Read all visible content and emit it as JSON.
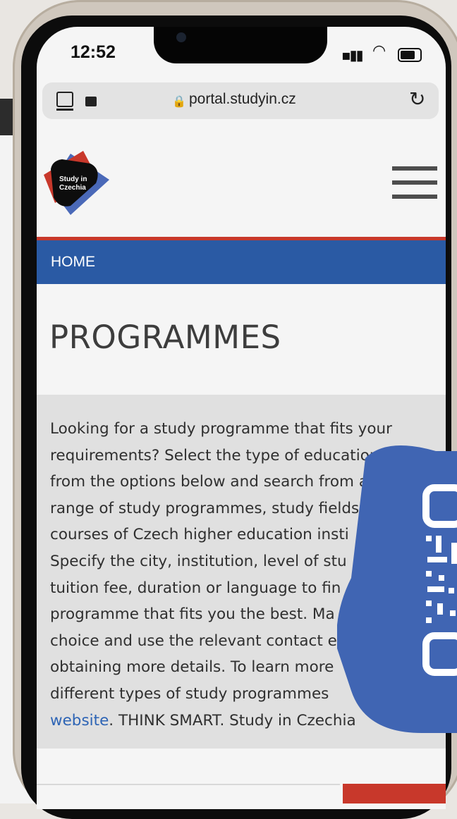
{
  "status_bar": {
    "time": "12:52"
  },
  "browser": {
    "url": "portal.studyin.cz"
  },
  "logo": {
    "line1": "Study in",
    "line2": "Czechia"
  },
  "breadcrumb": {
    "home": "HOME"
  },
  "page": {
    "title": "PROGRAMMES"
  },
  "intro": {
    "lines": [
      "Looking for a study programme that fits your",
      "requirements? Select the type of education",
      "from the options below and search from a",
      "range of study programmes, study fields",
      "courses of Czech higher education insti",
      "Specify the city, institution, level of stu",
      "tuition fee, duration or language to fin",
      "programme that fits you the best. Ma",
      "choice and use the relevant contact e",
      "obtaining more details. To learn more",
      "different types of study programmes"
    ],
    "link_text": "website",
    "tail_text": ". THINK SMART. Study in Czechia"
  },
  "colors": {
    "brand_blue": "#2a5aa4",
    "brand_red": "#c8382b",
    "badge_blue": "#4065b3"
  },
  "icons": {
    "tabs": "tabs-icon",
    "extension": "extension-icon",
    "lock": "lock-icon",
    "reload": "reload-icon",
    "menu": "hamburger-menu-icon",
    "qr": "qr-code-icon"
  }
}
